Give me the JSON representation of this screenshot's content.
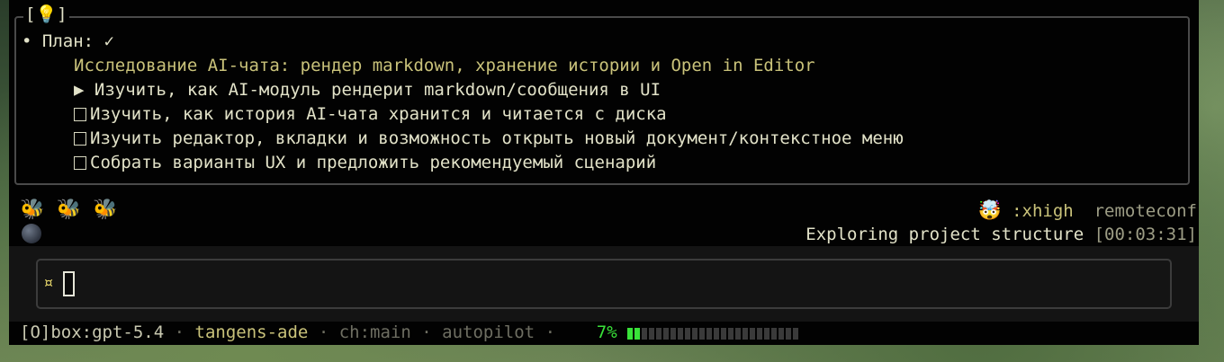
{
  "plan": {
    "tag_open": "[",
    "tag_icon": "💡",
    "tag_close": "]",
    "bullet": "•",
    "title": "План: ✓",
    "subtitle": "Исследование AI-чата: рендер markdown, хранение истории и Open in Editor",
    "tasks": [
      {
        "marker": "▶",
        "text": "Изучить, как AI-модуль рендерит markdown/сообщения в UI",
        "state": "in-progress"
      },
      {
        "marker": "☐",
        "text": "Изучить, как история AI-чата хранится и читается с диска",
        "state": "pending"
      },
      {
        "marker": "☐",
        "text": "Изучить редактор, вкладки и возможность открыть новый документ/контекстное меню",
        "state": "pending"
      },
      {
        "marker": "☐",
        "text": "Собрать варианты UX и предложить рекомендуемый сценарий",
        "state": "pending"
      }
    ]
  },
  "agents": {
    "bees": [
      "🐝",
      "🐝",
      "🐝"
    ],
    "moon": "🌑",
    "effort_icon": "🤯",
    "effort": ":xhigh",
    "profile": "remoteconf",
    "activity": "Exploring project structure",
    "elapsed": "[00:03:31]"
  },
  "input": {
    "prompt_glyph": "¤",
    "value": ""
  },
  "statusbar": {
    "model": "[O]box:gpt-5.4",
    "sep": "·",
    "project": "tangens-ade",
    "branch": "ch:main",
    "mode": "autopilot",
    "context_percent": "7%",
    "context_fraction": 0.07
  },
  "colors": {
    "terminal_bg": "#020202",
    "text": "#e2e2c8",
    "progress_on": "#39e239",
    "prompt": "#e4d46a"
  }
}
